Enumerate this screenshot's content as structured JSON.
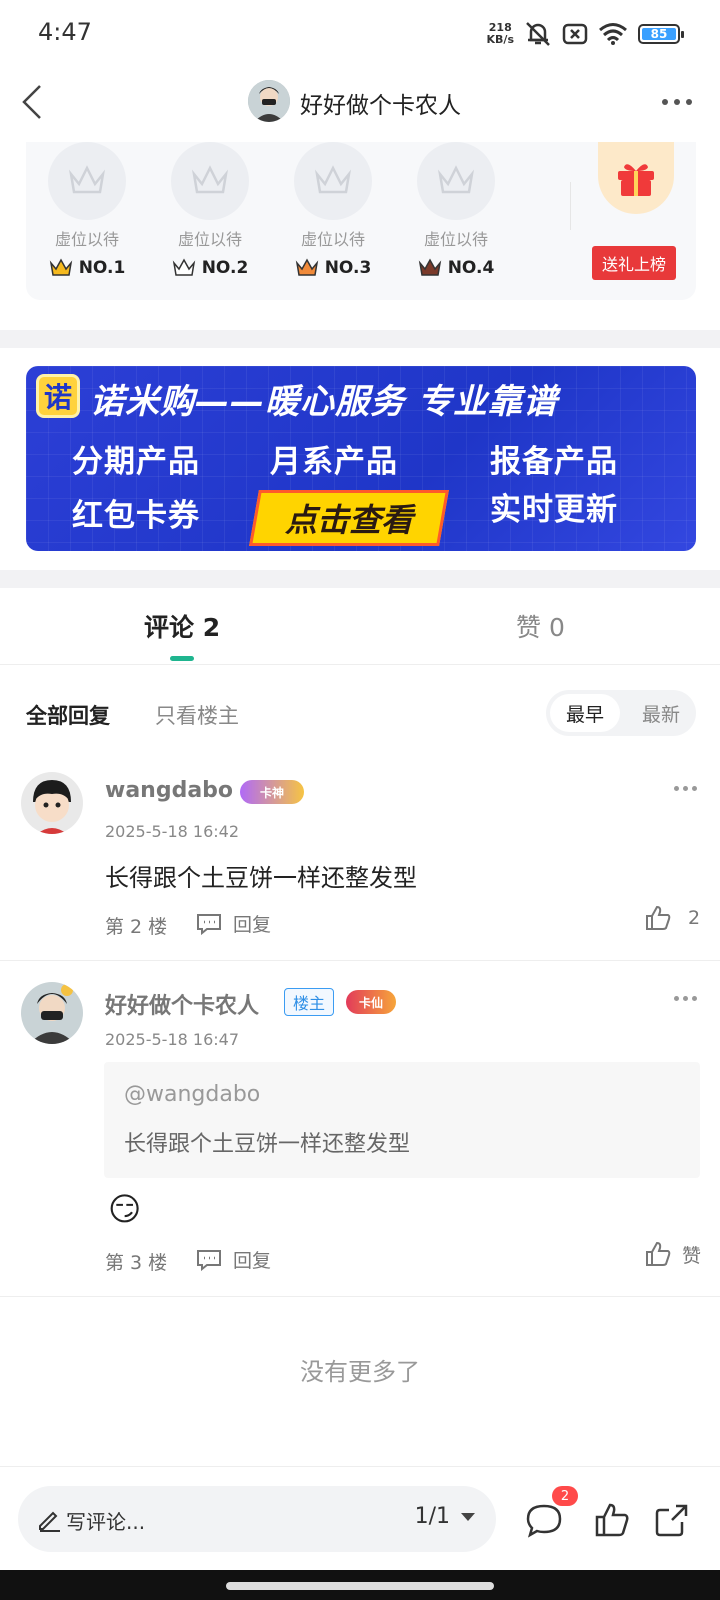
{
  "status_bar": {
    "time": "4:47",
    "net_speed_top": "218",
    "net_speed_bottom": "KB/s",
    "battery": "85"
  },
  "header": {
    "title": "好好做个卡农人"
  },
  "gift_rank": {
    "slots": [
      {
        "placeholder": "虚位以待",
        "rank": "NO.1",
        "crown_color": "#f5b91e"
      },
      {
        "placeholder": "虚位以待",
        "rank": "NO.2",
        "crown_color": "#444444"
      },
      {
        "placeholder": "虚位以待",
        "rank": "NO.3",
        "crown_color": "#f08a3a"
      },
      {
        "placeholder": "虚位以待",
        "rank": "NO.4",
        "crown_color": "#7a3a2a"
      }
    ],
    "gift_button": "送礼上榜"
  },
  "banner": {
    "logo": "诺",
    "headline": "诺米购——暖心服务 专业靠谱",
    "items": [
      "分期产品",
      "月系产品",
      "报备产品",
      "红包卡券",
      "实时更新"
    ],
    "cta": "点击查看"
  },
  "tabs": {
    "comments": "评论 2",
    "likes": "赞 0"
  },
  "filters": {
    "all": "全部回复",
    "owner_only": "只看楼主",
    "earliest": "最早",
    "newest": "最新"
  },
  "comments": [
    {
      "username": "wangdabo",
      "badge": "卡神",
      "time": "2025-5-18 16:42",
      "text": "长得跟个土豆饼一样还整发型",
      "floor": "第 2 楼",
      "reply": "回复",
      "likes": "2"
    },
    {
      "username": "好好做个卡农人",
      "owner_tag": "楼主",
      "badge": "卡仙",
      "time": "2025-5-18 16:47",
      "quote_user": "@wangdabo",
      "quote_text": "长得跟个土豆饼一样还整发型",
      "emoji": "😏",
      "floor": "第 3 楼",
      "reply": "回复",
      "likes": "赞"
    }
  ],
  "no_more": "没有更多了",
  "bottom_bar": {
    "write_comment": "写评论...",
    "pager": "1/1",
    "message_count": "2"
  },
  "colors": {
    "accent": "#1fb58f",
    "gift_red": "#e8393a",
    "banner_blue": "#2c3fd6",
    "owner_blue": "#2f8fe6"
  }
}
